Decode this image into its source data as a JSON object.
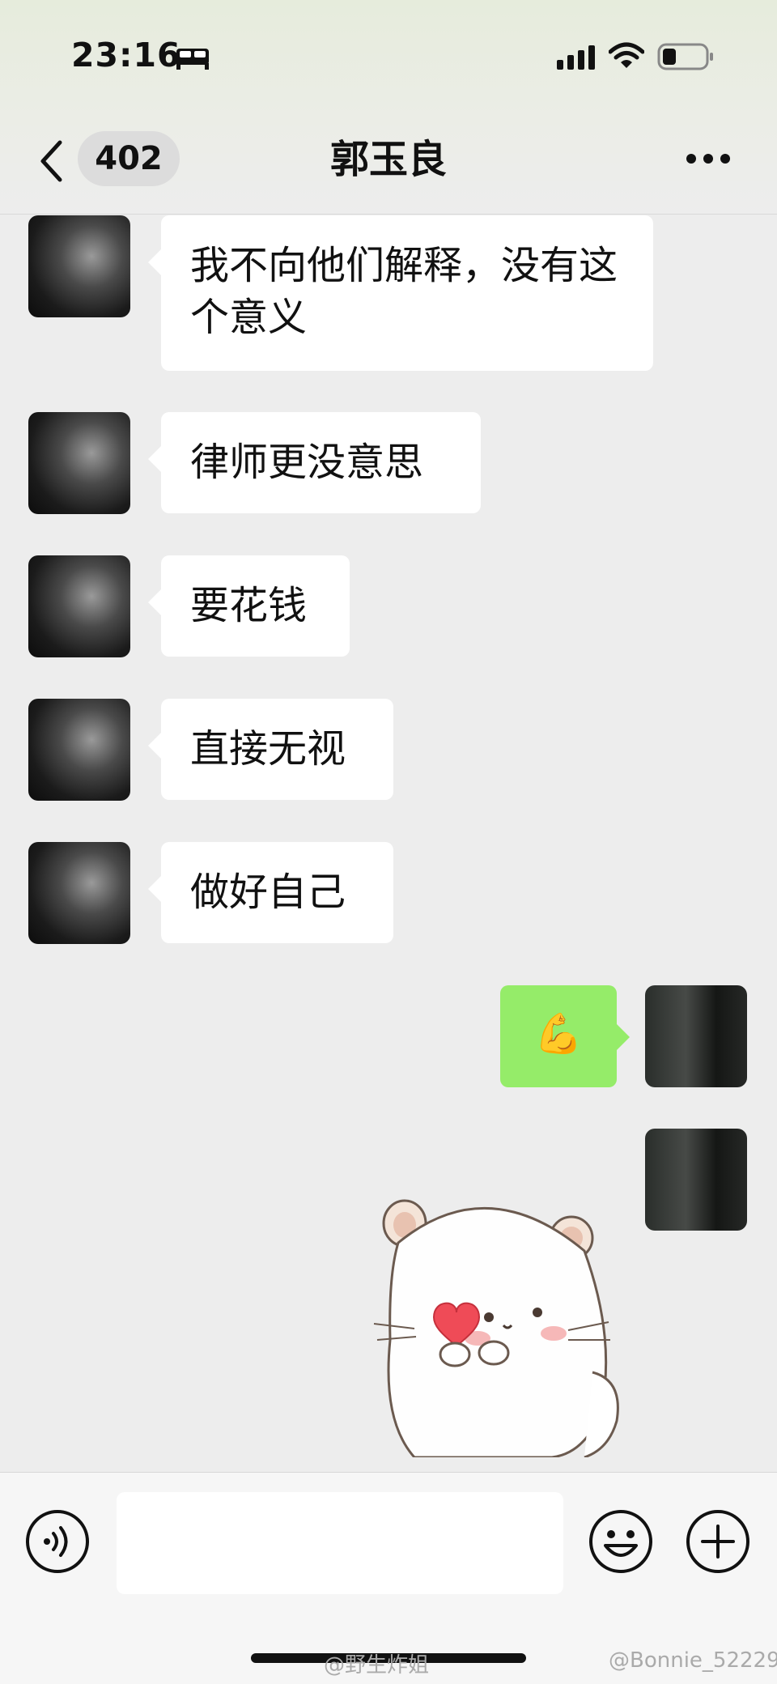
{
  "status_bar": {
    "time": "23:16"
  },
  "header": {
    "unread_count": "402",
    "title": "郭玉良"
  },
  "messages": [
    {
      "side": "left",
      "text": "我不向他们解释，没有这个意义"
    },
    {
      "side": "left",
      "text": "律师更没意思"
    },
    {
      "side": "left",
      "text": "要花钱"
    },
    {
      "side": "left",
      "text": "直接无视"
    },
    {
      "side": "left",
      "text": "做好自己"
    },
    {
      "side": "right",
      "emoji": "💪"
    },
    {
      "side": "right",
      "sticker": "hamster-heart-sticker"
    }
  ],
  "input": {
    "value": "",
    "placeholder": ""
  },
  "watermarks": {
    "left": "@野生炸姐",
    "right": "@Bonnie_52229"
  }
}
